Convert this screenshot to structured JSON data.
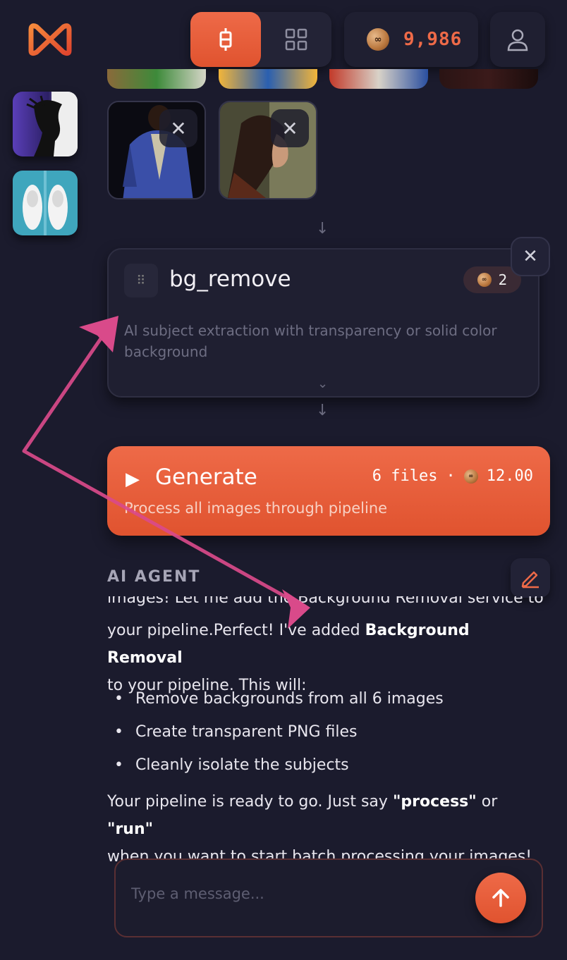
{
  "header": {
    "credits": "9,986",
    "accent_color": "#e85a3a",
    "icons": [
      "infinity-logo",
      "pipeline-icon",
      "grid-icon",
      "coin-icon",
      "user-icon"
    ]
  },
  "pipeline": {
    "node": {
      "title": "bg_remove",
      "cost": "2",
      "description": "AI subject extraction with transparency or solid color background"
    },
    "generate": {
      "title": "Generate",
      "files": "6 files",
      "separator": "·",
      "cost": "12.00",
      "subtitle": "Process all images through pipeline"
    }
  },
  "agent": {
    "label": "AI AGENT",
    "msg_partial": "images! Let me add the Background Removal service to",
    "msg_line2_pre": "your pipeline.Perfect! I've added ",
    "msg_line2_bold": "Background Removal",
    "msg_line3": "to your pipeline. This will:",
    "bullets": [
      "Remove backgrounds from all 6 images",
      "Create transparent PNG files",
      "Cleanly isolate the subjects"
    ],
    "closing_pre": "Your pipeline is ready to go. Just say ",
    "closing_bold1": "\"process\"",
    "closing_mid": " or ",
    "closing_bold2": "\"run\"",
    "closing_post": "when you want to start batch processing your images!"
  },
  "input": {
    "placeholder": "Type a message..."
  }
}
